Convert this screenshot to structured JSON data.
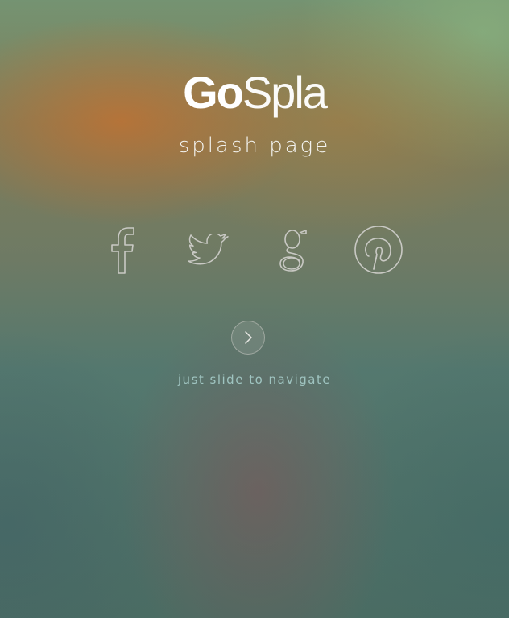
{
  "page": {
    "logo": {
      "part1": "Go",
      "part2": "Spla"
    },
    "tagline": "splash page",
    "hint": "just slide to navigate"
  },
  "social": [
    {
      "name": "facebook",
      "icon": "facebook-icon"
    },
    {
      "name": "twitter",
      "icon": "twitter-icon"
    },
    {
      "name": "google-plus",
      "icon": "google-icon"
    },
    {
      "name": "pinterest",
      "icon": "pinterest-icon"
    }
  ],
  "navigation": {
    "icon": "chevron-right-icon"
  },
  "colors": {
    "icon_stroke": "#c9c9c4",
    "text": "#ffffff",
    "hint": "#9fc4c0"
  }
}
